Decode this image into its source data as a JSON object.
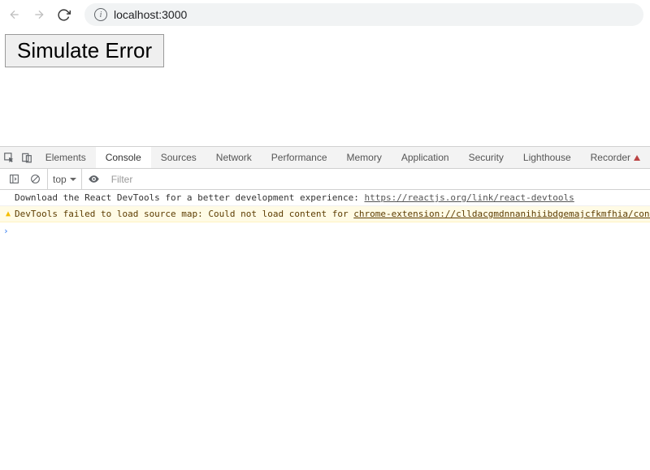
{
  "browser": {
    "url": "localhost:3000"
  },
  "page": {
    "simulate_label": "Simulate Error"
  },
  "devtools": {
    "tabs": {
      "elements": "Elements",
      "console": "Console",
      "sources": "Sources",
      "network": "Network",
      "performance": "Performance",
      "memory": "Memory",
      "application": "Application",
      "security": "Security",
      "lighthouse": "Lighthouse",
      "recorder": "Recorder"
    },
    "sub": {
      "context": "top",
      "filter_placeholder": "Filter"
    },
    "lines": [
      {
        "kind": "log",
        "text": "Download the React DevTools for a better development experience: ",
        "link": "https://reactjs.org/link/react-devtools"
      },
      {
        "kind": "warn",
        "text": "DevTools failed to load source map: Could not load content for ",
        "link": "chrome-extension://clldacgmdnnanihiibdgemajcfkmfhia/contentS"
      }
    ]
  }
}
